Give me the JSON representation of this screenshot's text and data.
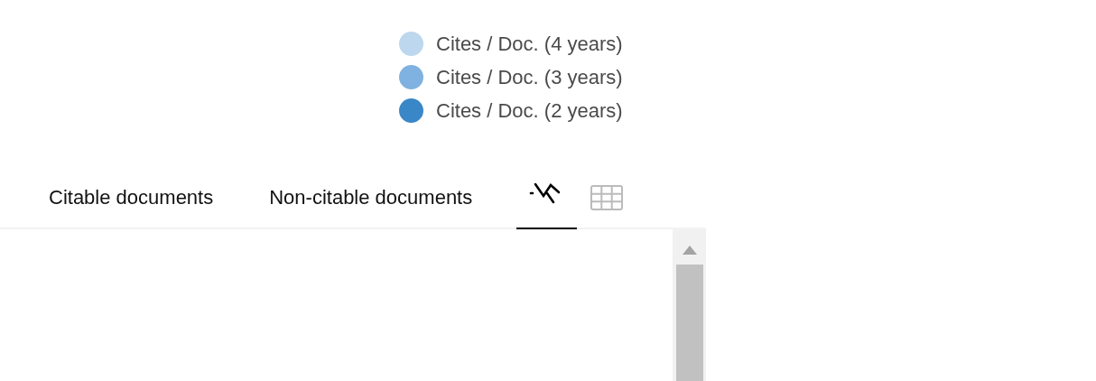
{
  "legend": [
    {
      "label": "Cites / Doc. (4 years)",
      "color": "#bdd7ee"
    },
    {
      "label": "Cites / Doc. (3 years)",
      "color": "#7fb2e0"
    },
    {
      "label": "Cites / Doc. (2 years)",
      "color": "#3a87c8"
    }
  ],
  "tabs": [
    {
      "kind": "text",
      "label": "Citable documents",
      "selected": false
    },
    {
      "kind": "text",
      "label": "Non-citable documents",
      "selected": false
    },
    {
      "kind": "chart",
      "selected": true
    },
    {
      "kind": "table",
      "selected": false
    }
  ]
}
